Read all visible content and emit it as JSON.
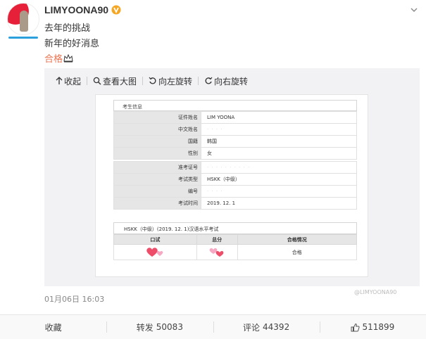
{
  "post": {
    "username": "LIMYOONA90",
    "lines": [
      "去年的挑战",
      "新年的好消息"
    ],
    "hashtag": "合格",
    "timestamp": "01月06日 16:03"
  },
  "toolbar": {
    "collapse": "收起",
    "view_large": "查看大图",
    "rotate_left": "向左旋转",
    "rotate_right": "向右旋转"
  },
  "certificate": {
    "section_title": "考生信息",
    "rows_a": [
      {
        "key": "证件姓名",
        "value": "LIM YOONA"
      },
      {
        "key": "中文姓名",
        "value": ""
      },
      {
        "key": "国籍",
        "value": "韩国"
      },
      {
        "key": "性别",
        "value": "女"
      }
    ],
    "rows_b": [
      {
        "key": "准考证号",
        "value": ""
      },
      {
        "key": "考试类型",
        "value": "HSKK（中级）"
      },
      {
        "key": "编号",
        "value": ""
      },
      {
        "key": "考试时间",
        "value": "2019. 12. 1"
      }
    ],
    "result_title": "HSKK（中级）(2019. 12. 1)汉语水平考试",
    "result_headers": [
      "口试",
      "总分",
      "合格情况"
    ],
    "result_status": "合格",
    "watermark": "@LIMYOONA90"
  },
  "actions": {
    "favorite": "收藏",
    "repost_label": "转发",
    "repost_count": "50083",
    "comment_label": "评论",
    "comment_count": "44392",
    "like_count": "511899"
  },
  "colors": {
    "hashtag": "#eb7350",
    "verified": "#f5a623",
    "avatar_red": "#e7203a"
  }
}
